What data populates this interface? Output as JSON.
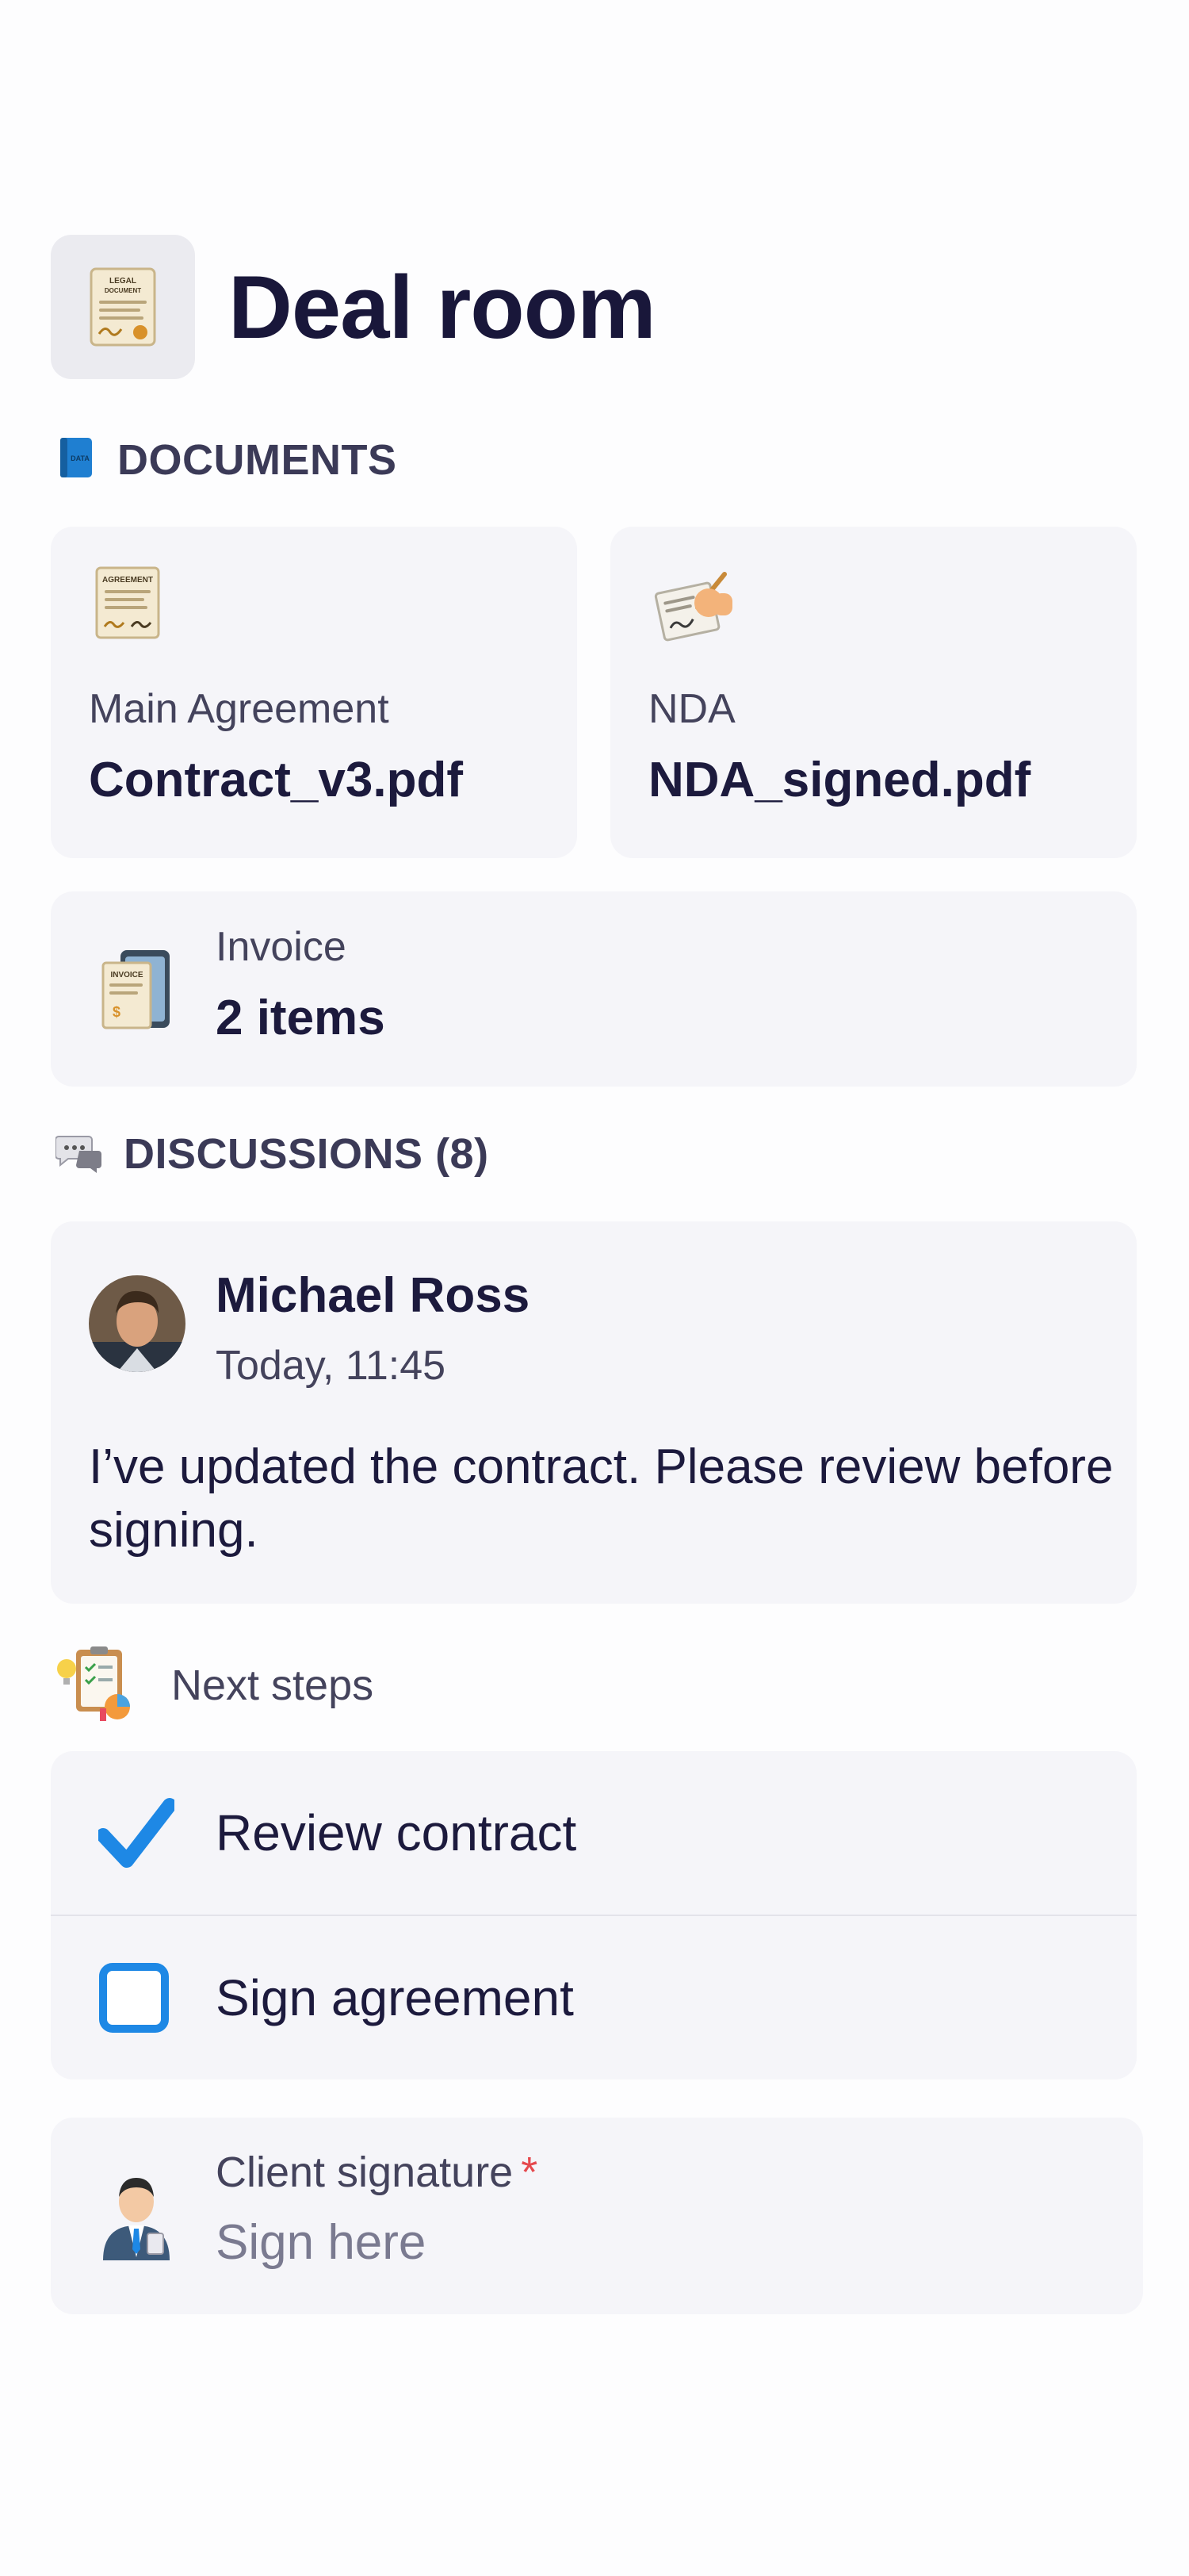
{
  "header": {
    "title": "Deal room",
    "icon": "legal-document-icon"
  },
  "documents": {
    "section_label": "DOCUMENTS",
    "items": [
      {
        "label": "Main Agreement",
        "value": "Contract_v3.pdf",
        "icon": "agreement-document-icon"
      },
      {
        "label": "NDA",
        "value": "NDA_signed.pdf",
        "icon": "signing-hand-icon"
      },
      {
        "label": "Invoice",
        "value": "2 items",
        "icon": "invoice-icon"
      }
    ]
  },
  "discussions": {
    "section_label": "DISCUSSIONS (8)",
    "post": {
      "author": "Michael Ross",
      "time": "Today, 11:45",
      "message": "I’ve updated the contract. Please review before signing."
    }
  },
  "next_steps": {
    "section_label": "Next steps",
    "items": [
      {
        "label": "Review contract",
        "checked": true
      },
      {
        "label": "Sign agreement",
        "checked": false
      }
    ]
  },
  "signature": {
    "label": "Client signature",
    "required_marker": "*",
    "placeholder": "Sign here"
  },
  "colors": {
    "title": "#19173a",
    "card_bg": "#f5f5f9",
    "accent_blue": "#1e88e5",
    "required_red": "#e5484d"
  }
}
